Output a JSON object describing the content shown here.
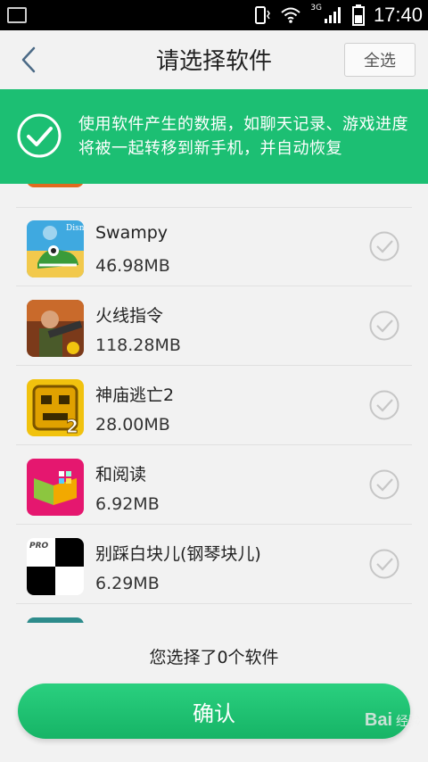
{
  "status_bar": {
    "network": "3G",
    "time": "17:40"
  },
  "header": {
    "title": "请选择软件",
    "select_all": "全选"
  },
  "banner": {
    "text": "使用软件产生的数据，如聊天记录、游戏进度将被一起转移到新手机，并自动恢复"
  },
  "apps": [
    {
      "name": "Swampy",
      "size": "46.98MB",
      "icon": "swampy-game-icon"
    },
    {
      "name": "火线指令",
      "size": "118.28MB",
      "icon": "soldier-game-icon"
    },
    {
      "name": "神庙逃亡2",
      "size": "28.00MB",
      "icon": "temple-run-2-icon"
    },
    {
      "name": "和阅读",
      "size": "6.92MB",
      "icon": "reading-app-icon"
    },
    {
      "name": "别踩白块儿(钢琴块儿)",
      "size": "6.29MB",
      "icon": "piano-tiles-icon"
    }
  ],
  "icon_badges": {
    "disney": "Disney",
    "pro": "PRO",
    "num2": "2"
  },
  "footer": {
    "count_text": "您选择了0个软件",
    "confirm": "确认"
  },
  "watermark": {
    "logo": "Bai",
    "text": "经验"
  },
  "colors": {
    "accent": "#1cbf73",
    "status_bar": "#000000",
    "background": "#f2f2f2"
  }
}
